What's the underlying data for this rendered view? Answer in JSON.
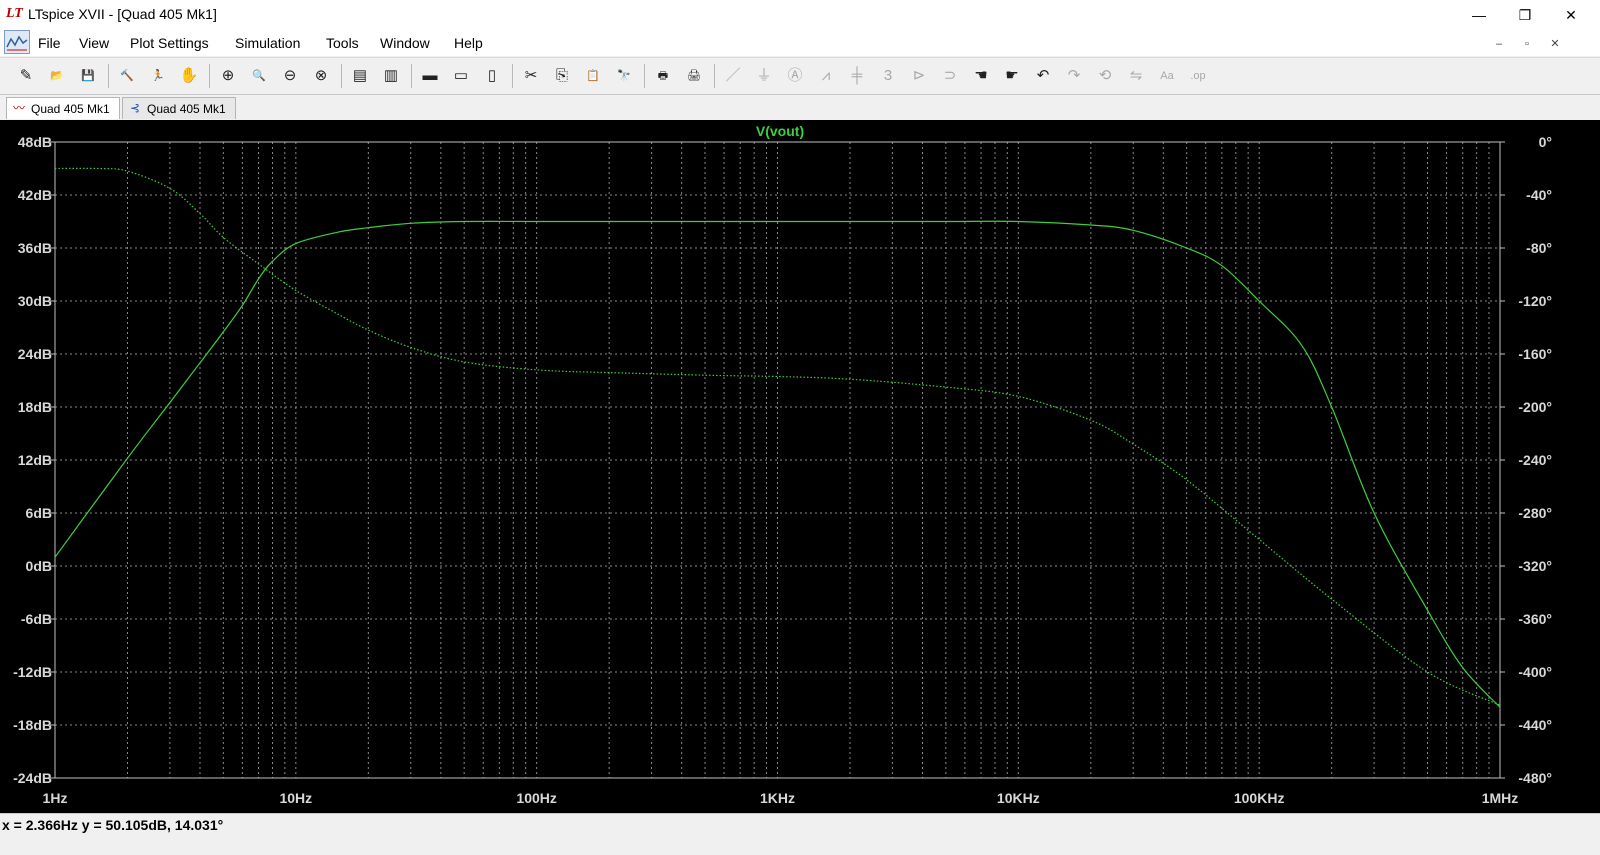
{
  "window": {
    "title": "LTspice XVII - [Quad 405 Mk1]",
    "logo": "LT",
    "controls": {
      "minimize": "—",
      "restore": "❐",
      "close": "✕"
    }
  },
  "menu": {
    "items": [
      "File",
      "View",
      "Plot Settings",
      "Simulation",
      "Tools",
      "Window",
      "Help"
    ],
    "mdi_controls": {
      "minimize": "–",
      "restore": "▫",
      "close": "✕"
    }
  },
  "toolbar": {
    "groups": [
      [
        "new-schematic-icon",
        "open-folder-icon",
        "save-icon"
      ],
      [
        "control-panel-icon",
        "run-icon",
        "halt-icon"
      ],
      [
        "zoom-in-icon",
        "zoom-out-icon",
        "zoom-back-icon",
        "zoom-fit-icon"
      ],
      [
        "autorange-icon",
        "fft-icon"
      ],
      [
        "tile-horizontal-icon",
        "cascade-icon",
        "tile-vertical-icon"
      ],
      [
        "cut-icon",
        "copy-icon",
        "paste-icon",
        "find-icon"
      ],
      [
        "print-icon",
        "print-preview-icon"
      ],
      [
        "wire-icon",
        "ground-icon",
        "label-icon",
        "resistor-icon",
        "capacitor-icon",
        "inductor-icon",
        "diode-icon",
        "component-icon",
        "move-icon",
        "drag-icon",
        "undo-icon",
        "redo-icon",
        "rotate-icon",
        "mirror-icon",
        "text-icon",
        "spice-directive-icon"
      ]
    ],
    "glyphs": {
      "new-schematic-icon": "✎",
      "open-folder-icon": "📂",
      "save-icon": "💾",
      "control-panel-icon": "🔨",
      "run-icon": "🏃",
      "halt-icon": "✋",
      "zoom-in-icon": "⊕",
      "zoom-out-icon": "🔍",
      "zoom-back-icon": "⊖",
      "zoom-fit-icon": "⊗",
      "autorange-icon": "▤",
      "fft-icon": "▥",
      "tile-horizontal-icon": "▬",
      "cascade-icon": "▭",
      "tile-vertical-icon": "▯",
      "cut-icon": "✂",
      "copy-icon": "⎘",
      "paste-icon": "📋",
      "find-icon": "🔭",
      "print-icon": "🖶",
      "print-preview-icon": "🖨",
      "wire-icon": "／",
      "ground-icon": "⏚",
      "label-icon": "Ⓐ",
      "resistor-icon": "⩘",
      "capacitor-icon": "╪",
      "inductor-icon": "3",
      "diode-icon": "⊳",
      "component-icon": "⊃",
      "move-icon": "☚",
      "drag-icon": "☛",
      "undo-icon": "↶",
      "redo-icon": "↷",
      "rotate-icon": "⟲",
      "mirror-icon": "⇋",
      "text-icon": "Aa",
      "spice-directive-icon": ".op"
    },
    "dimmed": [
      "wire-icon",
      "ground-icon",
      "label-icon",
      "resistor-icon",
      "capacitor-icon",
      "inductor-icon",
      "diode-icon",
      "component-icon",
      "redo-icon",
      "rotate-icon",
      "mirror-icon",
      "text-icon",
      "spice-directive-icon"
    ]
  },
  "tabs": [
    {
      "label": "Quad 405 Mk1",
      "icon": "waveform-icon",
      "active": true
    },
    {
      "label": "Quad 405 Mk1",
      "icon": "schematic-icon",
      "active": false
    }
  ],
  "status": {
    "text": "x = 2.366Hz    y = 50.105dB, 14.031°"
  },
  "colors": {
    "plot_bg": "#000000",
    "trace": "#3ecf3e",
    "trace_title": "#3ecf3e",
    "grid": "#8a8a8a",
    "axis_text": "#d8d8d8"
  },
  "chart_data": {
    "type": "line",
    "title": "V(vout)",
    "x_scale": "log",
    "xlim": [
      1,
      1000000
    ],
    "x_tick_labels": [
      "1Hz",
      "10Hz",
      "100Hz",
      "1KHz",
      "10KHz",
      "100KHz",
      "1MHz"
    ],
    "y_left": {
      "lim": [
        -24,
        48
      ],
      "ticks": [
        -24,
        -18,
        -12,
        -6,
        0,
        6,
        12,
        18,
        24,
        30,
        36,
        42,
        48
      ],
      "tick_labels": [
        "-24dB",
        "-18dB",
        "-12dB",
        "-6dB",
        "0dB",
        "6dB",
        "12dB",
        "18dB",
        "24dB",
        "30dB",
        "36dB",
        "42dB",
        "48dB"
      ]
    },
    "y_right": {
      "lim": [
        -480,
        0
      ],
      "ticks": [
        -480,
        -440,
        -400,
        -360,
        -320,
        -280,
        -240,
        -200,
        -160,
        -120,
        -80,
        -40,
        0
      ],
      "tick_labels": [
        "-480°",
        "-440°",
        "-400°",
        "-360°",
        "-320°",
        "-280°",
        "-240°",
        "-200°",
        "-160°",
        "-120°",
        "-80°",
        "-40°",
        "0°"
      ]
    },
    "grid": true,
    "series": [
      {
        "name": "V(vout)",
        "quantity": "magnitude",
        "axis": "left",
        "style": "solid",
        "x": [
          1,
          2,
          3,
          4,
          5,
          6,
          7,
          8,
          10,
          15,
          20,
          30,
          50,
          100,
          200,
          500,
          1000,
          2000,
          5000,
          10000,
          20000,
          30000,
          50000,
          70000,
          100000,
          150000,
          200000,
          300000,
          500000,
          700000,
          1000000
        ],
        "values": [
          1,
          12.2,
          18.5,
          23,
          26.5,
          29.5,
          32.5,
          34.5,
          36.5,
          37.8,
          38.3,
          38.8,
          39,
          39,
          39,
          39,
          39,
          39,
          39,
          39,
          38.6,
          38,
          36,
          34,
          30,
          25,
          18,
          6,
          -5,
          -11.5,
          -16
        ]
      },
      {
        "name": "V(vout)",
        "quantity": "phase",
        "axis": "right",
        "style": "dotted",
        "x": [
          1,
          1.5,
          2,
          3,
          4,
          5,
          7,
          10,
          15,
          20,
          30,
          50,
          100,
          200,
          500,
          1000,
          2000,
          5000,
          10000,
          20000,
          30000,
          50000,
          100000,
          200000,
          500000,
          1000000
        ],
        "values": [
          -20,
          -20,
          -22,
          -35,
          -54,
          -72,
          -92,
          -112,
          -130,
          -142,
          -155,
          -166,
          -172,
          -174,
          -176,
          -177,
          -179,
          -185,
          -192,
          -210,
          -228,
          -255,
          -300,
          -345,
          -400,
          -425
        ]
      }
    ]
  }
}
